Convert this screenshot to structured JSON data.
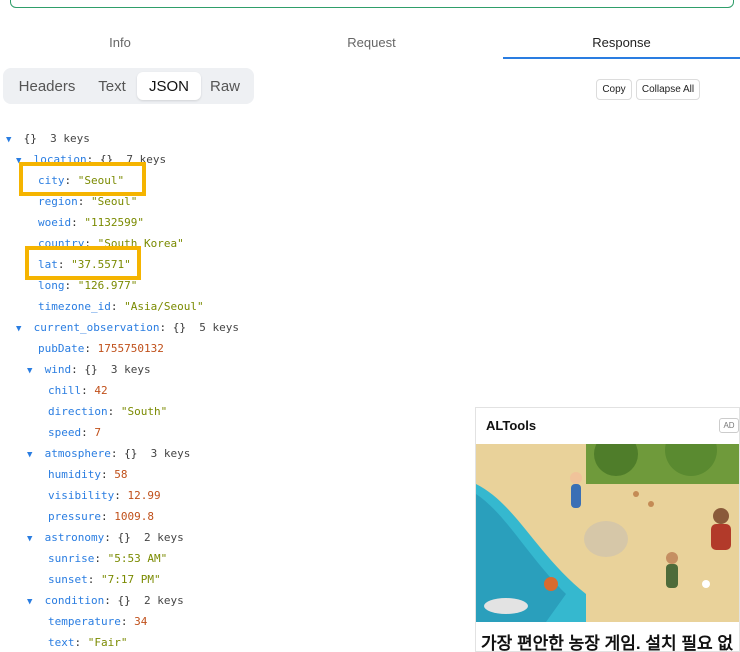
{
  "tabs": [
    "Info",
    "Request",
    "Response"
  ],
  "active_tab": "Response",
  "views": [
    "Headers",
    "Text",
    "JSON",
    "Raw"
  ],
  "active_view": "JSON",
  "buttons": {
    "copy": "Copy",
    "collapse_all": "Collapse All"
  },
  "tree": {
    "root": {
      "braces": "{}",
      "count": "3 keys"
    },
    "location": {
      "key": "location",
      "braces": "{}",
      "count": "7 keys",
      "city": {
        "key": "city",
        "value": "\"Seoul\""
      },
      "region": {
        "key": "region",
        "value": "\"Seoul\""
      },
      "woeid": {
        "key": "woeid",
        "value": "\"1132599\""
      },
      "country": {
        "key": "country",
        "value": "\"South Korea\""
      },
      "lat": {
        "key": "lat",
        "value": "\"37.5571\""
      },
      "long": {
        "key": "long",
        "value": "\"126.977\""
      },
      "timezone_id": {
        "key": "timezone_id",
        "value": "\"Asia/Seoul\""
      }
    },
    "current_observation": {
      "key": "current_observation",
      "braces": "{}",
      "count": "5 keys",
      "pubDate": {
        "key": "pubDate",
        "value": "1755750132"
      },
      "wind": {
        "key": "wind",
        "braces": "{}",
        "count": "3 keys",
        "chill": {
          "key": "chill",
          "value": "42"
        },
        "direction": {
          "key": "direction",
          "value": "\"South\""
        },
        "speed": {
          "key": "speed",
          "value": "7"
        }
      },
      "atmosphere": {
        "key": "atmosphere",
        "braces": "{}",
        "count": "3 keys",
        "humidity": {
          "key": "humidity",
          "value": "58"
        },
        "visibility": {
          "key": "visibility",
          "value": "12.99"
        },
        "pressure": {
          "key": "pressure",
          "value": "1009.8"
        }
      },
      "astronomy": {
        "key": "astronomy",
        "braces": "{}",
        "count": "2 keys",
        "sunrise": {
          "key": "sunrise",
          "value": "\"5:53 AM\""
        },
        "sunset": {
          "key": "sunset",
          "value": "\"7:17 PM\""
        }
      },
      "condition": {
        "key": "condition",
        "braces": "{}",
        "count": "2 keys",
        "temperature": {
          "key": "temperature",
          "value": "34"
        },
        "text": {
          "key": "text",
          "value": "\"Fair\""
        }
      }
    }
  },
  "ad": {
    "brand": "ALTools",
    "badge": "AD",
    "title": "가장 편안한 농장 게임. 설치 필요 없"
  },
  "colors": {
    "accent": "#2a7de1",
    "highlight": "#f5b400",
    "string": "#7a8a00",
    "number": "#c0501a"
  }
}
